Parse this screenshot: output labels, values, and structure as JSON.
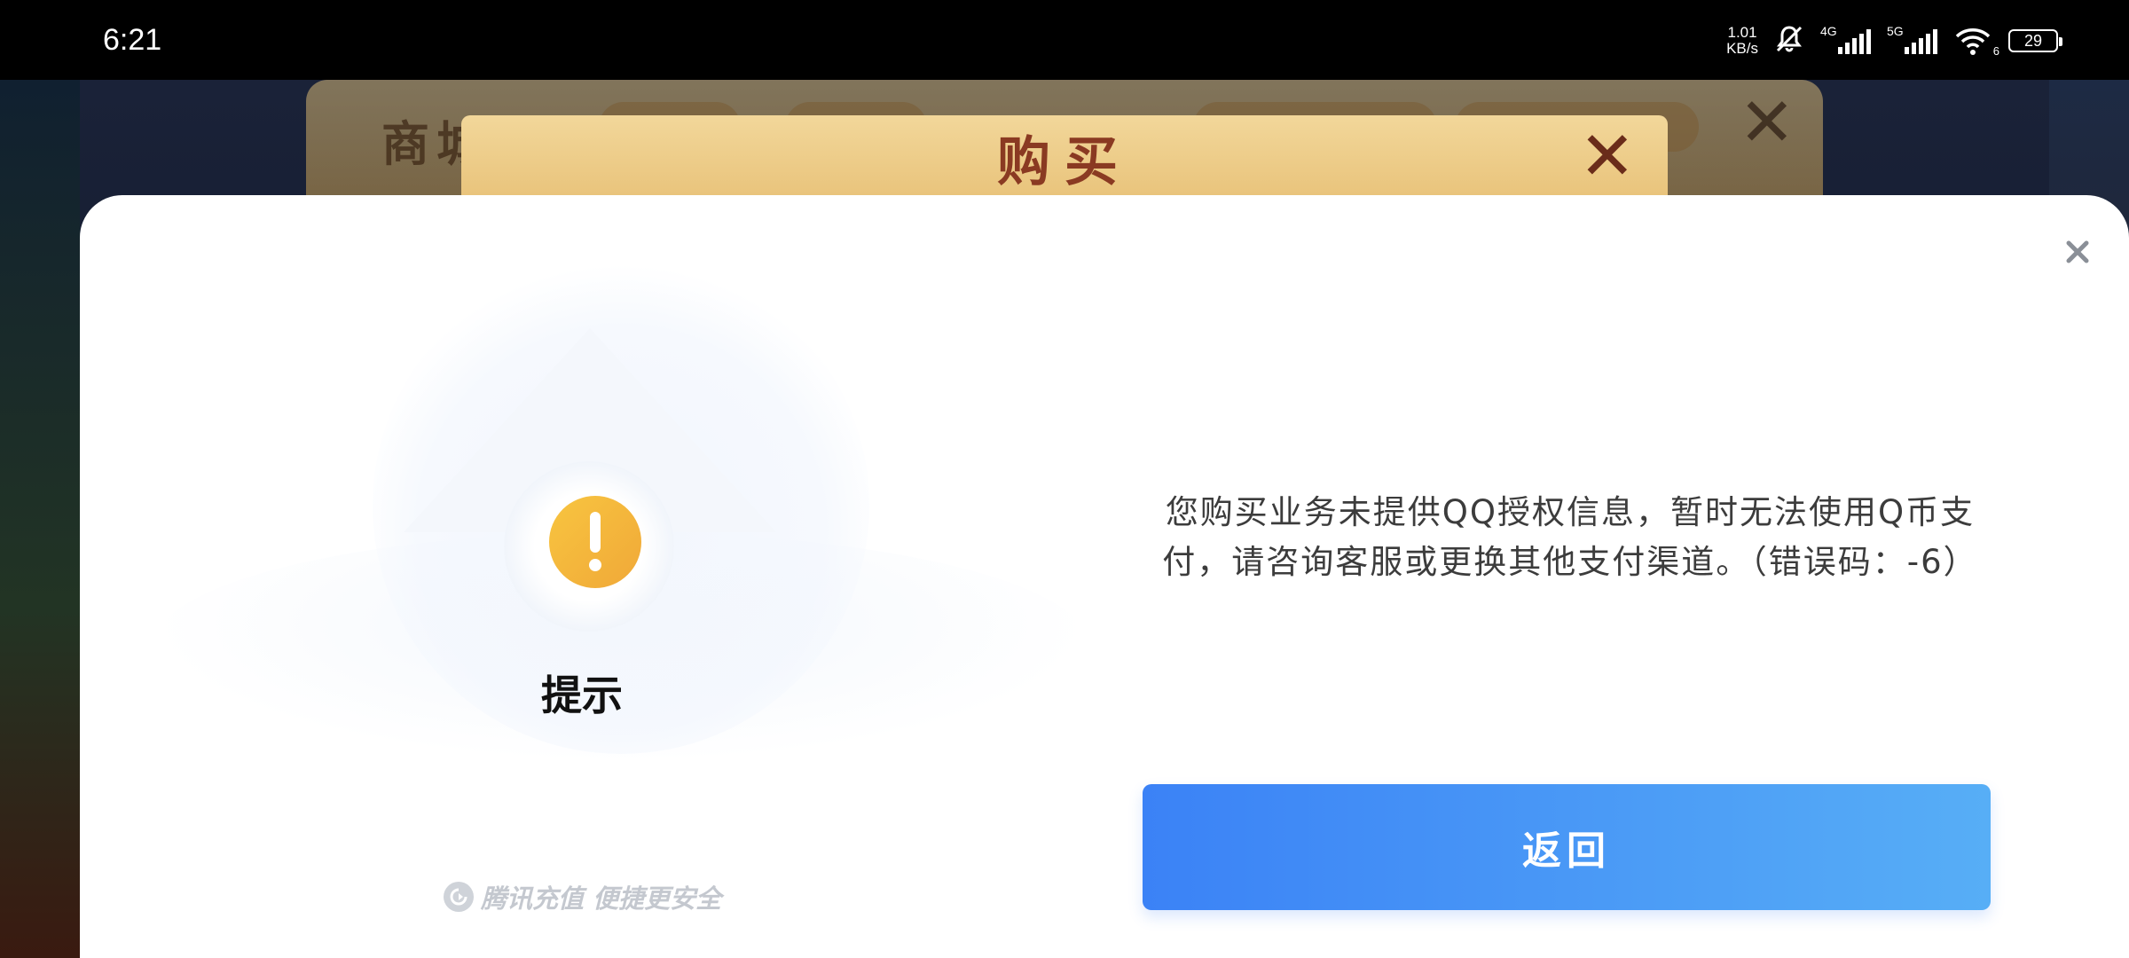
{
  "status_bar": {
    "time": "6:21",
    "net_speed_value": "1.01",
    "net_speed_unit": "KB/s",
    "signal_4g_label": "4G",
    "signal_5g_label": "5G",
    "wifi_label": "6",
    "battery_level": "29"
  },
  "background_game": {
    "shop_title": "商城",
    "buy_title": "购买"
  },
  "dialog": {
    "title": "提示",
    "message": "您购买业务未提供QQ授权信息，暂时无法使用Q币支付，请咨询客服或更换其他支付渠道。（错误码：-6）",
    "return_label": "返回",
    "brand_text": "腾讯充值 便捷更安全",
    "warning_icon": "exclamation-icon",
    "close_icon": "close-icon"
  },
  "colors": {
    "accent_blue_start": "#3b82f6",
    "accent_blue_end": "#57aef6",
    "warning_yellow": "#f6b73c"
  }
}
